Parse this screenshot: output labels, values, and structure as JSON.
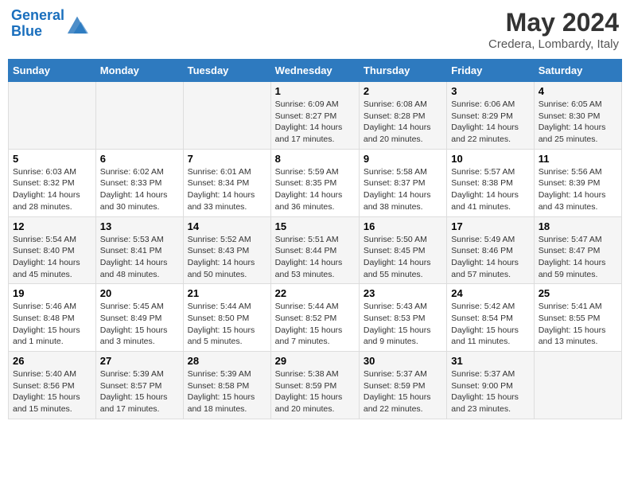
{
  "header": {
    "logo_line1": "General",
    "logo_line2": "Blue",
    "title": "May 2024",
    "subtitle": "Credera, Lombardy, Italy"
  },
  "days_of_week": [
    "Sunday",
    "Monday",
    "Tuesday",
    "Wednesday",
    "Thursday",
    "Friday",
    "Saturday"
  ],
  "weeks": [
    [
      {
        "day": "",
        "info": ""
      },
      {
        "day": "",
        "info": ""
      },
      {
        "day": "",
        "info": ""
      },
      {
        "day": "1",
        "info": "Sunrise: 6:09 AM\nSunset: 8:27 PM\nDaylight: 14 hours and 17 minutes."
      },
      {
        "day": "2",
        "info": "Sunrise: 6:08 AM\nSunset: 8:28 PM\nDaylight: 14 hours and 20 minutes."
      },
      {
        "day": "3",
        "info": "Sunrise: 6:06 AM\nSunset: 8:29 PM\nDaylight: 14 hours and 22 minutes."
      },
      {
        "day": "4",
        "info": "Sunrise: 6:05 AM\nSunset: 8:30 PM\nDaylight: 14 hours and 25 minutes."
      }
    ],
    [
      {
        "day": "5",
        "info": "Sunrise: 6:03 AM\nSunset: 8:32 PM\nDaylight: 14 hours and 28 minutes."
      },
      {
        "day": "6",
        "info": "Sunrise: 6:02 AM\nSunset: 8:33 PM\nDaylight: 14 hours and 30 minutes."
      },
      {
        "day": "7",
        "info": "Sunrise: 6:01 AM\nSunset: 8:34 PM\nDaylight: 14 hours and 33 minutes."
      },
      {
        "day": "8",
        "info": "Sunrise: 5:59 AM\nSunset: 8:35 PM\nDaylight: 14 hours and 36 minutes."
      },
      {
        "day": "9",
        "info": "Sunrise: 5:58 AM\nSunset: 8:37 PM\nDaylight: 14 hours and 38 minutes."
      },
      {
        "day": "10",
        "info": "Sunrise: 5:57 AM\nSunset: 8:38 PM\nDaylight: 14 hours and 41 minutes."
      },
      {
        "day": "11",
        "info": "Sunrise: 5:56 AM\nSunset: 8:39 PM\nDaylight: 14 hours and 43 minutes."
      }
    ],
    [
      {
        "day": "12",
        "info": "Sunrise: 5:54 AM\nSunset: 8:40 PM\nDaylight: 14 hours and 45 minutes."
      },
      {
        "day": "13",
        "info": "Sunrise: 5:53 AM\nSunset: 8:41 PM\nDaylight: 14 hours and 48 minutes."
      },
      {
        "day": "14",
        "info": "Sunrise: 5:52 AM\nSunset: 8:43 PM\nDaylight: 14 hours and 50 minutes."
      },
      {
        "day": "15",
        "info": "Sunrise: 5:51 AM\nSunset: 8:44 PM\nDaylight: 14 hours and 53 minutes."
      },
      {
        "day": "16",
        "info": "Sunrise: 5:50 AM\nSunset: 8:45 PM\nDaylight: 14 hours and 55 minutes."
      },
      {
        "day": "17",
        "info": "Sunrise: 5:49 AM\nSunset: 8:46 PM\nDaylight: 14 hours and 57 minutes."
      },
      {
        "day": "18",
        "info": "Sunrise: 5:47 AM\nSunset: 8:47 PM\nDaylight: 14 hours and 59 minutes."
      }
    ],
    [
      {
        "day": "19",
        "info": "Sunrise: 5:46 AM\nSunset: 8:48 PM\nDaylight: 15 hours and 1 minute."
      },
      {
        "day": "20",
        "info": "Sunrise: 5:45 AM\nSunset: 8:49 PM\nDaylight: 15 hours and 3 minutes."
      },
      {
        "day": "21",
        "info": "Sunrise: 5:44 AM\nSunset: 8:50 PM\nDaylight: 15 hours and 5 minutes."
      },
      {
        "day": "22",
        "info": "Sunrise: 5:44 AM\nSunset: 8:52 PM\nDaylight: 15 hours and 7 minutes."
      },
      {
        "day": "23",
        "info": "Sunrise: 5:43 AM\nSunset: 8:53 PM\nDaylight: 15 hours and 9 minutes."
      },
      {
        "day": "24",
        "info": "Sunrise: 5:42 AM\nSunset: 8:54 PM\nDaylight: 15 hours and 11 minutes."
      },
      {
        "day": "25",
        "info": "Sunrise: 5:41 AM\nSunset: 8:55 PM\nDaylight: 15 hours and 13 minutes."
      }
    ],
    [
      {
        "day": "26",
        "info": "Sunrise: 5:40 AM\nSunset: 8:56 PM\nDaylight: 15 hours and 15 minutes."
      },
      {
        "day": "27",
        "info": "Sunrise: 5:39 AM\nSunset: 8:57 PM\nDaylight: 15 hours and 17 minutes."
      },
      {
        "day": "28",
        "info": "Sunrise: 5:39 AM\nSunset: 8:58 PM\nDaylight: 15 hours and 18 minutes."
      },
      {
        "day": "29",
        "info": "Sunrise: 5:38 AM\nSunset: 8:59 PM\nDaylight: 15 hours and 20 minutes."
      },
      {
        "day": "30",
        "info": "Sunrise: 5:37 AM\nSunset: 8:59 PM\nDaylight: 15 hours and 22 minutes."
      },
      {
        "day": "31",
        "info": "Sunrise: 5:37 AM\nSunset: 9:00 PM\nDaylight: 15 hours and 23 minutes."
      },
      {
        "day": "",
        "info": ""
      }
    ]
  ]
}
